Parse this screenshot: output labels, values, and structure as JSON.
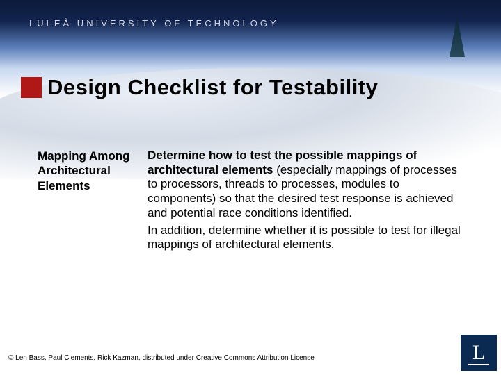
{
  "university": "LULEÅ UNIVERSITY OF TECHNOLOGY",
  "title": "Design Checklist for Testability",
  "table": {
    "left": "Mapping Among Architectural Elements",
    "right": {
      "p1_bold": "Determine how to test the possible mappings of architectural elements",
      "p1_rest": " (especially mappings of processes to processors, threads to processes, modules to components) so that the desired test response is achieved and potential race conditions identified.",
      "p2": "In addition, determine whether it is possible to test for illegal mappings of architectural elements."
    }
  },
  "footer": "© Len Bass, Paul Clements, Rick Kazman, distributed under Creative Commons Attribution License",
  "logo_letter": "L"
}
